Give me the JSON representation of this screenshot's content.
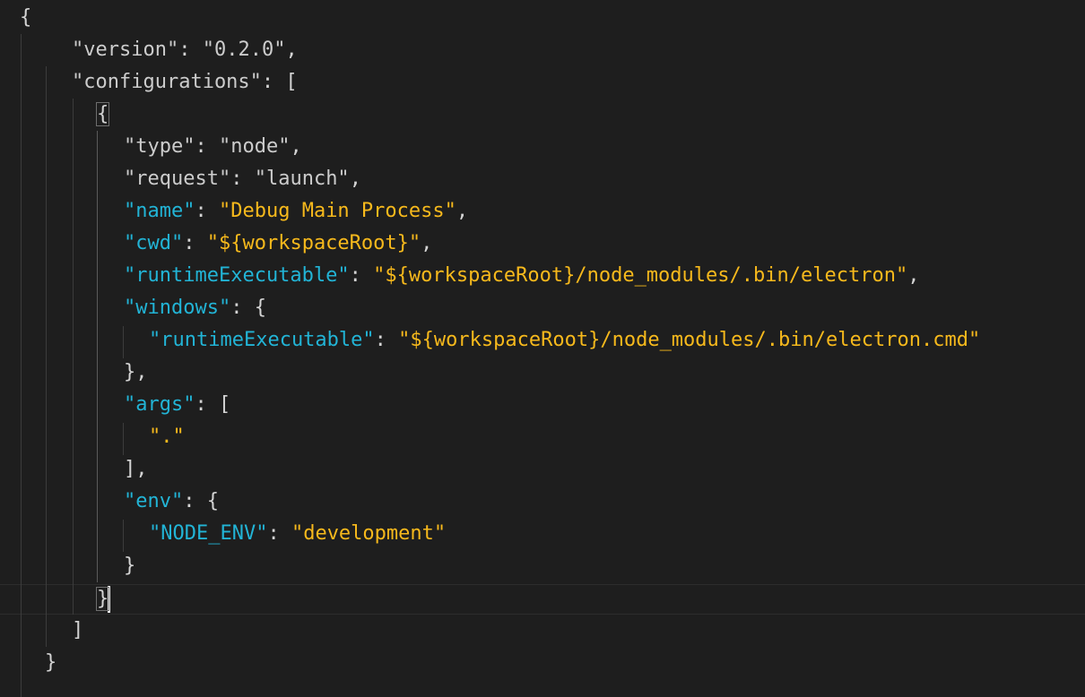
{
  "editor": {
    "open_brace": "{",
    "version_key": "\"version\"",
    "version_value": "\"0.2.0\"",
    "configurations_key": "\"configurations\"",
    "open_bracket": "[",
    "config_open": "{",
    "type_key": "\"type\"",
    "type_value": "\"node\"",
    "request_key": "\"request\"",
    "request_value": "\"launch\"",
    "name_key": "\"name\"",
    "name_value": "\"Debug Main Process\"",
    "cwd_key": "\"cwd\"",
    "cwd_value": "\"${workspaceRoot}\"",
    "runtime_key": "\"runtimeExecutable\"",
    "runtime_value": "\"${workspaceRoot}/node_modules/.bin/electron\"",
    "windows_key": "\"windows\"",
    "windows_runtime_key": "\"runtimeExecutable\"",
    "windows_runtime_value": "\"${workspaceRoot}/node_modules/.bin/electron.cmd\"",
    "windows_close": "},",
    "args_key": "\"args\"",
    "args_value": "\".\"",
    "args_close": "],",
    "env_key": "\"env\"",
    "node_env_key": "\"NODE_ENV\"",
    "node_env_value": "\"development\"",
    "env_close": "}",
    "config_close": "}",
    "close_bracket": "]",
    "close_brace": "}"
  },
  "colors": {
    "background": "#1e1e1e",
    "punctuation": "#d4d4d4",
    "highlight_key": "#22b4d6",
    "highlight_string": "#f7b91c"
  }
}
